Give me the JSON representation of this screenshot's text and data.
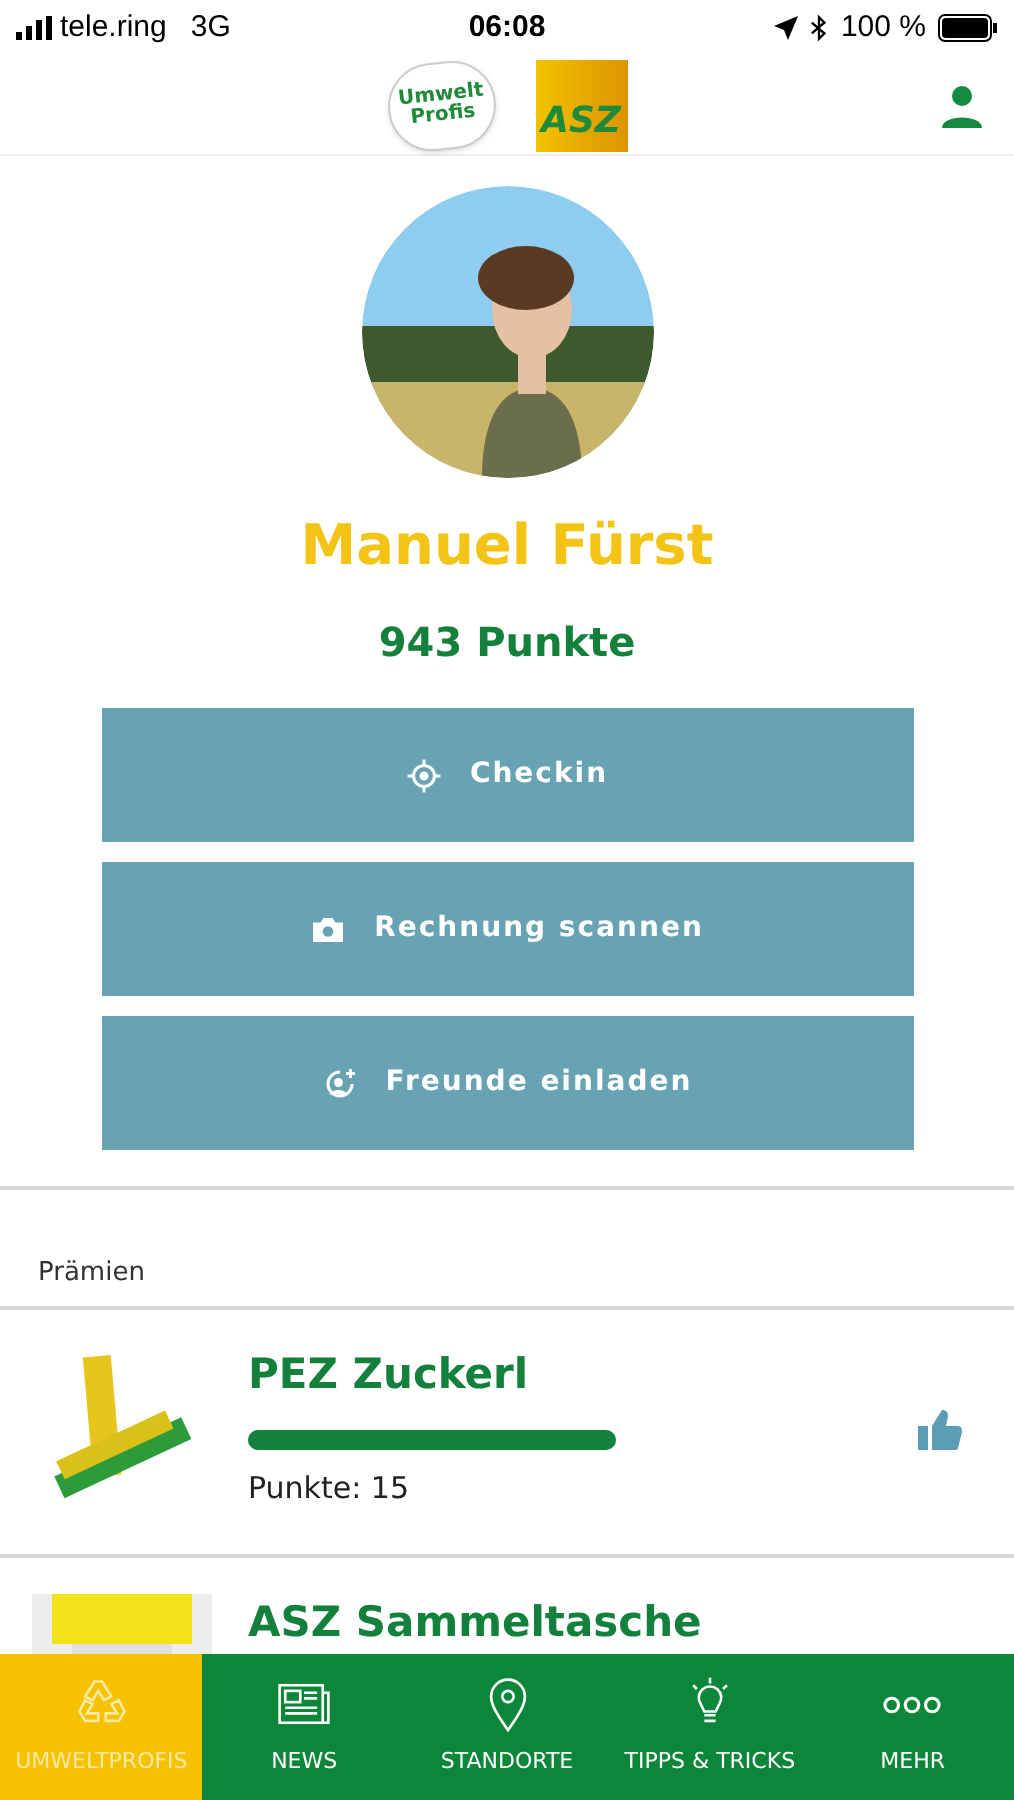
{
  "status_bar": {
    "carrier": "tele.ring",
    "network": "3G",
    "time": "06:08",
    "battery": "100 %"
  },
  "header": {
    "logo_1_line_1": "Umwelt",
    "logo_1_line_2": "Profis",
    "logo_2": "ASZ"
  },
  "profile": {
    "name": "Manuel Fürst",
    "points": "943 Punkte"
  },
  "actions": [
    {
      "kind": "checkin",
      "label": "Checkin"
    },
    {
      "kind": "camera",
      "label": "Rechnung scannen"
    },
    {
      "kind": "invite",
      "label": "Freunde einladen"
    }
  ],
  "rewards": {
    "title": "Prämien",
    "items": [
      {
        "name": "PEZ Zuckerl",
        "level": 1,
        "points": "Punkte: 15",
        "liked": true
      },
      {
        "name": "ASZ Sammeltasche"
      }
    ]
  },
  "tabs": [
    {
      "kind": "recycle",
      "label": "UMWELTPROFIS",
      "selected": true
    },
    {
      "kind": "news",
      "label": "NEWS",
      "selected": false
    },
    {
      "kind": "pin",
      "label": "STANDORTE",
      "selected": false
    },
    {
      "kind": "bulb",
      "label": "TIPPS & TRICKS",
      "selected": false
    },
    {
      "kind": "more",
      "label": "MEHR",
      "selected": false
    }
  ]
}
